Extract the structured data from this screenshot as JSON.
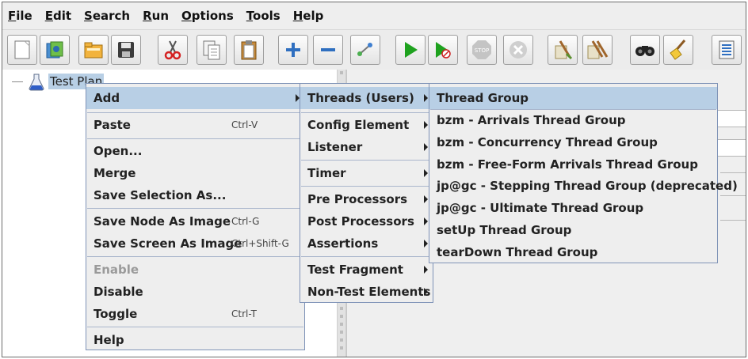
{
  "menubar": [
    {
      "mn": "F",
      "rest": "ile"
    },
    {
      "mn": "E",
      "rest": "dit"
    },
    {
      "mn": "S",
      "rest": "earch"
    },
    {
      "mn": "R",
      "rest": "un"
    },
    {
      "mn": "O",
      "rest": "ptions"
    },
    {
      "mn": "T",
      "rest": "ools"
    },
    {
      "mn": "H",
      "rest": "elp"
    }
  ],
  "toolbar": {
    "icons": [
      "new-icon",
      "templates-icon",
      "open-icon",
      "save-icon",
      "cut-icon",
      "copy-icon",
      "paste-icon",
      "expand-all-icon",
      "collapse-all-icon",
      "toggle-icon",
      "start-icon",
      "start-no-pauses-icon",
      "stop-icon",
      "shutdown-icon",
      "clear-icon",
      "clear-all-icon",
      "search-icon",
      "reset-search-icon",
      "function-helper-icon"
    ]
  },
  "tree": {
    "root_label": "Test Plan"
  },
  "context_menu": {
    "items": [
      {
        "label": "Add",
        "accel": "",
        "submenu": true,
        "selected": true,
        "disabled": false
      },
      {
        "label": "Paste",
        "accel": "Ctrl-V"
      },
      {
        "label": "Open...",
        "accel": ""
      },
      {
        "label": "Merge",
        "accel": ""
      },
      {
        "label": "Save Selection As...",
        "accel": ""
      },
      {
        "label": "Save Node As Image",
        "accel": "Ctrl-G"
      },
      {
        "label": "Save Screen As Image",
        "accel": "Ctrl+Shift-G"
      },
      {
        "label": "Enable",
        "accel": "",
        "disabled": true
      },
      {
        "label": "Disable",
        "accel": ""
      },
      {
        "label": "Toggle",
        "accel": "Ctrl-T"
      },
      {
        "label": "Help",
        "accel": ""
      }
    ]
  },
  "add_submenu": {
    "items": [
      {
        "label": "Threads (Users)",
        "selected": true
      },
      {
        "label": "Config Element"
      },
      {
        "label": "Listener"
      },
      {
        "label": "Timer"
      },
      {
        "label": "Pre Processors"
      },
      {
        "label": "Post Processors"
      },
      {
        "label": "Assertions"
      },
      {
        "label": "Test Fragment"
      },
      {
        "label": "Non-Test Elements"
      }
    ]
  },
  "threads_submenu": {
    "items": [
      {
        "label": "Thread Group",
        "selected": true
      },
      {
        "label": "bzm - Arrivals Thread Group"
      },
      {
        "label": "bzm - Concurrency Thread Group"
      },
      {
        "label": "bzm - Free-Form Arrivals Thread Group"
      },
      {
        "label": "jp@gc - Stepping Thread Group (deprecated)"
      },
      {
        "label": "jp@gc - Ultimate Thread Group"
      },
      {
        "label": "setUp Thread Group"
      },
      {
        "label": "tearDown Thread Group"
      }
    ]
  },
  "colors": {
    "selection": "#b8cfe5",
    "menu_border": "#7f93b7",
    "background": "#eeeeee"
  }
}
